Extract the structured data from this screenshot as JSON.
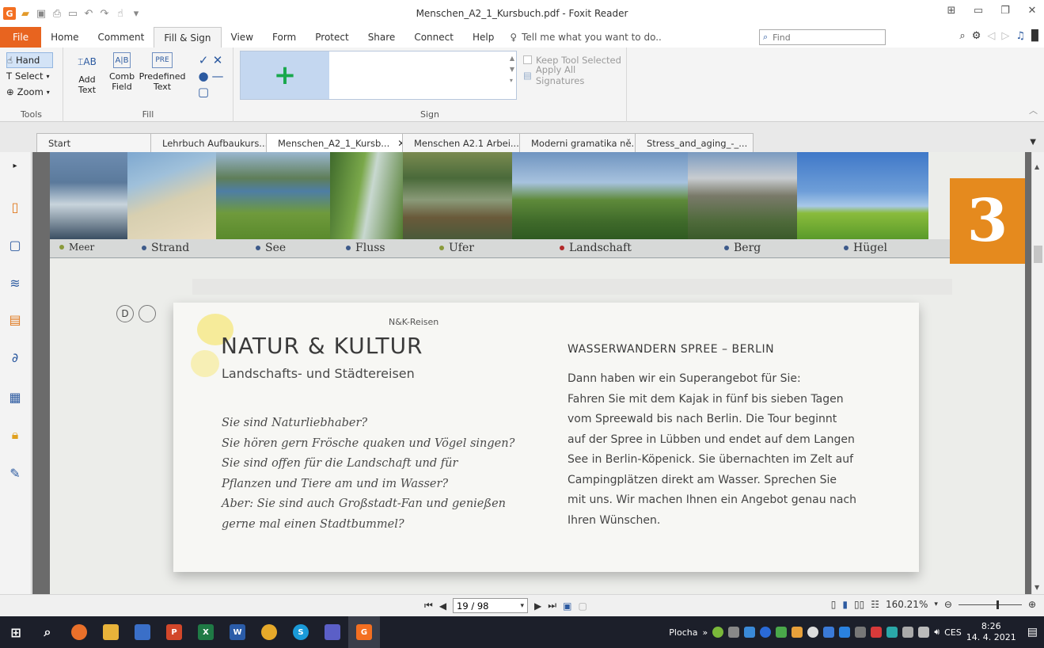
{
  "window": {
    "title": "Menschen_A2_1_Kursbuch.pdf - Foxit Reader",
    "app_logo": "G"
  },
  "menu": {
    "file": "File",
    "tabs": [
      "Home",
      "Comment",
      "Fill & Sign",
      "View",
      "Form",
      "Protect",
      "Share",
      "Connect",
      "Help"
    ],
    "active_tab": "Fill & Sign",
    "tell_me": "Tell me what you want to do..",
    "find_placeholder": "Find"
  },
  "ribbon": {
    "tools": {
      "hand": "Hand",
      "select": "Select",
      "zoom": "Zoom",
      "label": "Tools"
    },
    "fill": {
      "add_text_line1": "Add",
      "add_text_line2": "Text",
      "comb_field_line1": "Comb",
      "comb_field_line2": "Field",
      "predefined_line1": "Predefined",
      "predefined_line2": "Text",
      "label": "Fill"
    },
    "sign": {
      "keep_tool": "Keep Tool Selected",
      "apply_all": "Apply All Signatures",
      "label": "Sign"
    }
  },
  "doc_tabs": [
    "Start",
    "Lehrbuch Aufbaukurs....",
    "Menschen_A2_1_Kursb...",
    "Menschen A2.1 Arbei...",
    "Moderni gramatika ně...",
    "Stress_and_aging_-_..."
  ],
  "active_doc_tab": 2,
  "page": {
    "chapter": "3",
    "captions": [
      {
        "text": "Meer",
        "color": "#8a9a3b"
      },
      {
        "text": "Strand",
        "color": "#3d5a8a"
      },
      {
        "text": "See",
        "color": "#3d5a8a"
      },
      {
        "text": "Fluss",
        "color": "#3d5a8a"
      },
      {
        "text": "Ufer",
        "color": "#8a9a3b"
      },
      {
        "text": "Landschaft",
        "color": "#b22a2a"
      },
      {
        "text": "Berg",
        "color": "#3d5a8a"
      },
      {
        "text": "Hügel",
        "color": "#3d5a8a"
      }
    ],
    "markers": [
      "D",
      ""
    ],
    "ad": {
      "brand": "N&K-Reisen",
      "title": "NATUR & KULTUR",
      "subtitle": "Landschafts- und Städtereisen",
      "questions": [
        "Sie sind Naturliebhaber?",
        "Sie hören gern Frösche quaken und Vögel singen?",
        "Sie sind offen für die Landschaft und für",
        "Pflanzen und Tiere am und im Wasser?",
        "Aber: Sie sind auch Großstadt-Fan und genießen",
        "gerne mal einen Stadtbummel?"
      ],
      "right_title": "WASSERWANDERN SPREE – BERLIN",
      "right_lines": [
        "Dann haben wir ein Superangebot für Sie:",
        "Fahren Sie mit dem Kajak in fünf bis sieben Tagen",
        "vom Spreewald bis nach Berlin. Die Tour beginnt",
        "auf der Spree in Lübben und endet auf dem Langen",
        "See in Berlin-Köpenick. Sie übernachten im Zelt auf",
        "Campingplätzen direkt am Wasser. Sprechen Sie",
        "mit uns. Wir machen Ihnen ein Angebot genau nach",
        "Ihren Wünschen."
      ]
    }
  },
  "status": {
    "page_input": "19 / 98",
    "zoom": "160.21%"
  },
  "taskbar": {
    "location": "Plocha",
    "lang": "CES",
    "time": "8:26",
    "date": "14. 4. 2021"
  }
}
